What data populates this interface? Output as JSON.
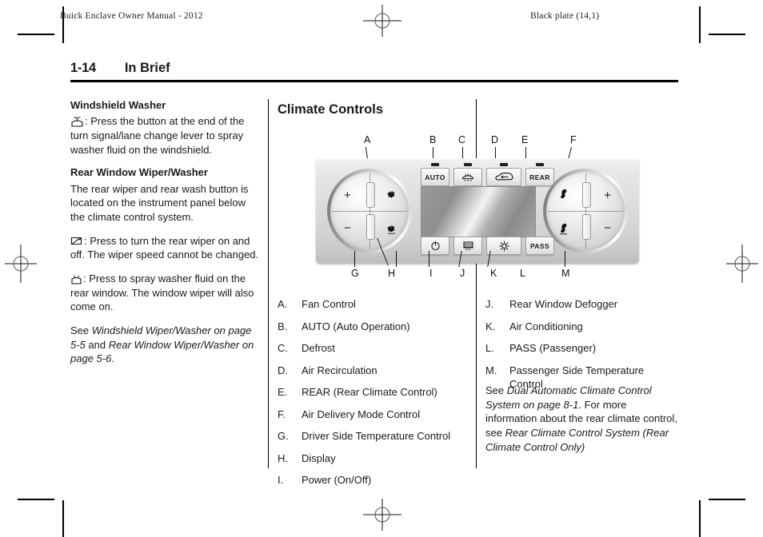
{
  "running_head": {
    "left": "Buick Enclave Owner Manual - 2012",
    "right": "Black plate (14,1)"
  },
  "page_header": {
    "page_number": "1-14",
    "chapter": "In Brief"
  },
  "column_1": {
    "heading_1": "Windshield Washer",
    "para_1": ":  Press the button at the end of the turn signal/lane change lever to spray washer fluid on the windshield.",
    "heading_2": "Rear Window Wiper/Washer",
    "para_2": "The rear wiper and rear wash button is located on the instrument panel below the climate control system.",
    "para_3": ":  Press to turn the rear wiper on and off. The wiper speed cannot be changed.",
    "para_4": ":  Press to spray washer fluid on the rear window. The window wiper will also come on.",
    "see_prefix": "See ",
    "see_ref_1": "Windshield Wiper/Washer on page 5-5",
    "see_mid": " and ",
    "see_ref_2": "Rear Window Wiper/Washer on page 5-6",
    "see_suffix": "."
  },
  "section": {
    "title": "Climate Controls"
  },
  "figure": {
    "callouts_top": [
      "A",
      "B",
      "C",
      "D",
      "E",
      "F"
    ],
    "callouts_bottom": [
      "G",
      "H",
      "I",
      "J",
      "K",
      "L",
      "M"
    ],
    "buttons_top": [
      {
        "label": "AUTO",
        "icon": "auto-text"
      },
      {
        "label": "",
        "icon": "defrost-icon"
      },
      {
        "label": "",
        "icon": "air-recirculation-icon"
      },
      {
        "label": "REAR",
        "icon": "rear-text"
      }
    ],
    "buttons_bottom": [
      {
        "label": "",
        "icon": "power-icon"
      },
      {
        "label": "",
        "icon": "rear-defogger-icon"
      },
      {
        "label": "",
        "icon": "air-conditioning-icon"
      },
      {
        "label": "PASS",
        "icon": "pass-text"
      }
    ],
    "knob_left": {
      "plus": "+",
      "minus": "−",
      "icon_top": "fan-high-icon",
      "icon_bottom": "fan-low-icon"
    },
    "knob_right": {
      "plus": "+",
      "minus": "−",
      "icon_top": "air-delivery-upper-icon",
      "icon_bottom": "air-delivery-lower-icon"
    }
  },
  "legend_left": [
    {
      "key": "A.",
      "text": "Fan Control"
    },
    {
      "key": "B.",
      "text": "AUTO (Auto Operation)"
    },
    {
      "key": "C.",
      "text": "Defrost"
    },
    {
      "key": "D.",
      "text": "Air Recirculation"
    },
    {
      "key": "E.",
      "text": "REAR (Rear Climate Control)"
    },
    {
      "key": "F.",
      "text": "Air Delivery Mode Control"
    },
    {
      "key": "G.",
      "text": "Driver Side Temperature Control"
    },
    {
      "key": "H.",
      "text": "Display"
    },
    {
      "key": "I.",
      "text": "Power (On/Off)"
    }
  ],
  "legend_right": [
    {
      "key": "J.",
      "text": "Rear Window Defogger"
    },
    {
      "key": "K.",
      "text": "Air Conditioning"
    },
    {
      "key": "L.",
      "text": "PASS (Passenger)"
    },
    {
      "key": "M.",
      "text": "Passenger Side Temperature Control"
    }
  ],
  "column_3_note": {
    "prefix": "See ",
    "ref_1": "Dual Automatic Climate Control System on page 8-1",
    "mid": ". For more information about the rear climate control, see ",
    "ref_2": "Rear Climate Control System (Rear Climate Control Only)"
  },
  "colors": {
    "ink": "#1a1a1a",
    "rule": "#000000",
    "panel_light": "#f2f2f2",
    "panel_dark": "#bdbdbd"
  }
}
